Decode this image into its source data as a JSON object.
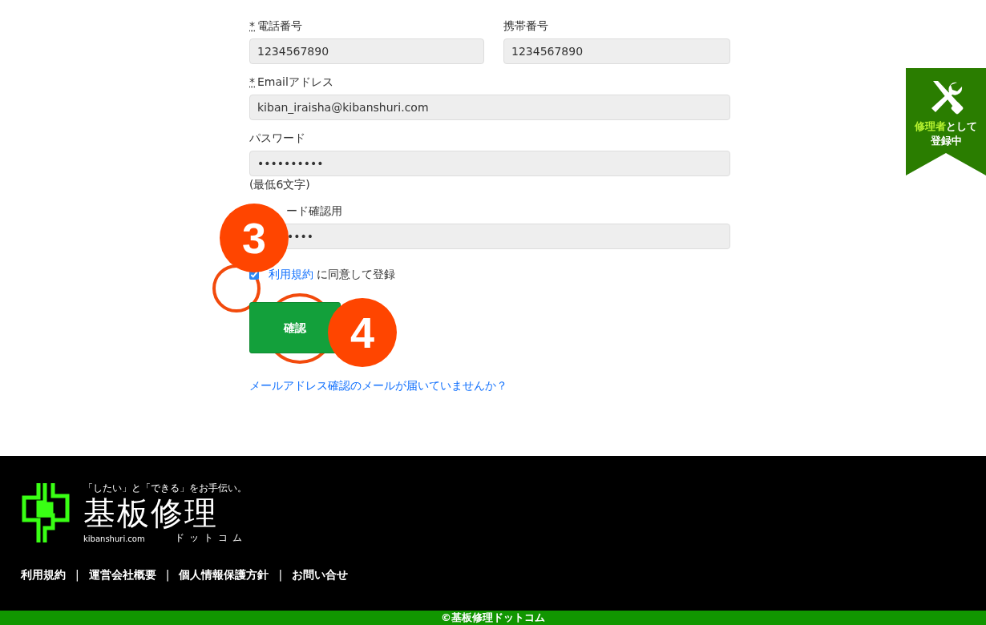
{
  "form": {
    "rows": [
      {
        "fields": [
          {
            "mark": "*",
            "label": "電話番号",
            "value": "1234567890"
          },
          {
            "label": "携帯番号",
            "value": "1234567890"
          }
        ]
      },
      {
        "fields": [
          {
            "mark": "*",
            "label": "Emailアドレス",
            "value": "kiban_iraisha@kibanshuri.com"
          }
        ]
      },
      {
        "fields": [
          {
            "label": "パスワード",
            "value": "••••••••••",
            "hint": "(最低6文字)"
          }
        ]
      },
      {
        "fields": [
          {
            "label": "ード確認用",
            "value": "••••",
            "indent": true
          }
        ]
      }
    ],
    "agree": {
      "checked": true,
      "link": "利用規約",
      "text": " に同意して登録"
    },
    "submit": "確認",
    "resend_link": "メールアドレス確認のメールが届いていませんか？"
  },
  "annotations": [
    {
      "number": "3"
    },
    {
      "number": "4"
    }
  ],
  "ribbon": {
    "line1": [
      {
        "text": "修理者",
        "highlight": true
      },
      {
        "text": "として",
        "highlight": false
      }
    ],
    "line2": "登録中"
  },
  "footer": {
    "tagline": "「したい」と「できる」をお手伝い。",
    "logo_title": "基板修理",
    "domain": "kibanshuri.com",
    "logo_sub": "ドットコム",
    "links": [
      {
        "label": "利用規約"
      },
      {
        "label": "運営会社概要"
      },
      {
        "label": "個人情報保護方針"
      },
      {
        "label": "お問い合せ"
      }
    ],
    "separators": [
      "|",
      "|",
      "|"
    ],
    "copyright": "©基板修理ドットコム"
  }
}
